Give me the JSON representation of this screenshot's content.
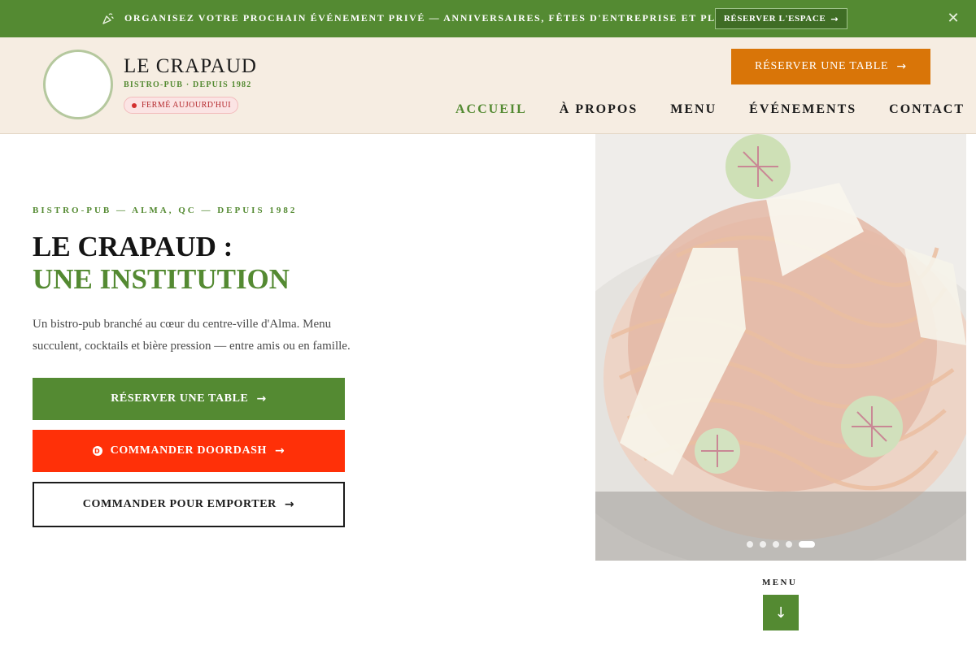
{
  "announcement": {
    "icon": "confetti-icon",
    "message": "ORGANISEZ VOTRE PROCHAIN ÉVÉNEMENT PRIVÉ — ANNIVERSAIRES, FÊTES D'ENTREPRISE ET PLUS",
    "cta_label": "RÉSERVER L'ESPACE",
    "cta_arrow": "→",
    "close_glyph": "✕",
    "background": "#548a32"
  },
  "header": {
    "brand_name": "LE CRAPAUD",
    "brand_sub": "BISTRO-PUB · DEPUIS 1982",
    "status_label": "FERMÉ AUJOURD'HUI",
    "reserve_label": "RÉSERVER UNE TABLE",
    "reserve_arrow": "→",
    "accent": "#d97508",
    "nav": [
      {
        "label": "ACCUEIL",
        "active": true
      },
      {
        "label": "À PROPOS",
        "active": false
      },
      {
        "label": "MENU",
        "active": false
      },
      {
        "label": "ÉVÉNEMENTS",
        "active": false
      },
      {
        "label": "CONTACT",
        "active": false
      }
    ]
  },
  "hero": {
    "kicker": "BISTRO-PUB — ALMA, QC — DEPUIS 1982",
    "title_line1": "LE CRAPAUD :",
    "title_line2": "UNE INSTITUTION",
    "description": "Un bistro-pub branché au cœur du centre-ville d'Alma. Menu succulent, cocktails et bière pression — entre amis ou en famille.",
    "buttons": {
      "reserve": "RÉSERVER UNE TABLE",
      "doordash": "COMMANDER DOORDASH",
      "doordash_logo": "D",
      "takeout": "COMMANDER POUR EMPORTER",
      "arrow": "→"
    },
    "carousel": {
      "slide_count": 5,
      "active_index": 4
    },
    "scroll_label": "MENU",
    "scroll_arrow": "↓"
  },
  "colors": {
    "green": "#548a32",
    "orange": "#d97508",
    "doordash_red": "#ff3008",
    "cream": "#f6ede2"
  }
}
